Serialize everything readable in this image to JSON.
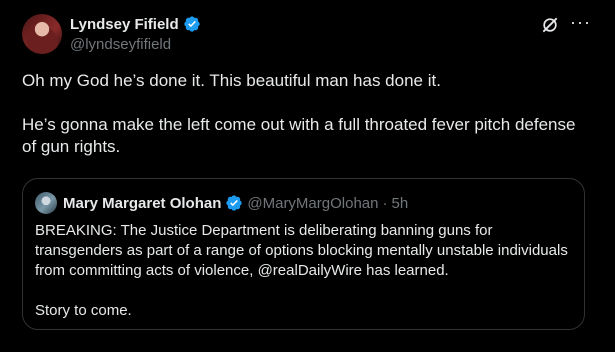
{
  "author": {
    "display_name": "Lyndsey Fifield",
    "handle": "@lyndseyfifield",
    "verified_color": "#1d9bf0"
  },
  "tweet": {
    "text": "Oh my God he’s done it. This beautiful man has done it.\n\nHe’s gonna make the left come out with a full throated fever pitch defense of gun rights."
  },
  "header_actions": {
    "grok_icon": "grok-icon",
    "more_icon": "···"
  },
  "quote": {
    "display_name": "Mary Margaret Olohan",
    "handle": "@MaryMargOlohan",
    "separator": "·",
    "time": "5h",
    "text": "BREAKING: The Justice Department is deliberating banning guns for transgenders as part of a range of options blocking mentally unstable individuals from committing acts of violence, @realDailyWire has learned.\n\nStory to come."
  }
}
